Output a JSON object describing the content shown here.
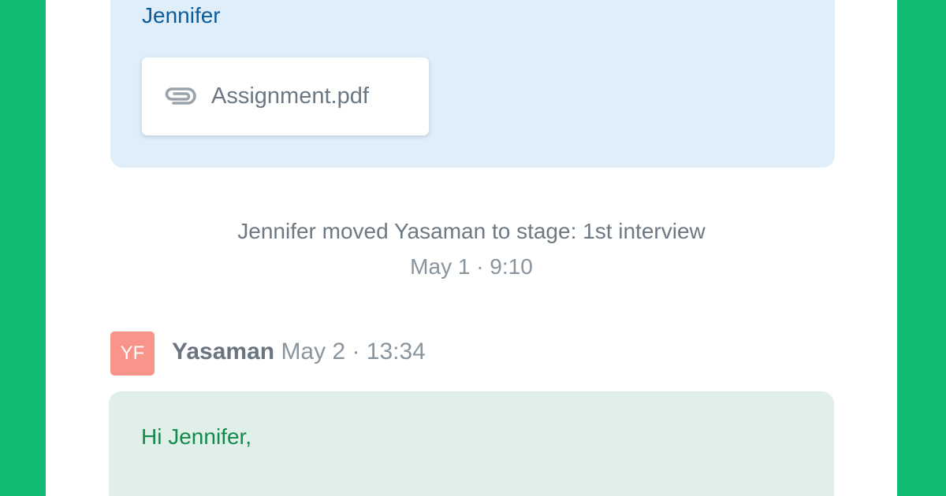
{
  "message_previous": {
    "sender": "Jennifer",
    "attachment": {
      "icon": "paperclip-icon",
      "filename": "Assignment.pdf"
    }
  },
  "event": {
    "text": "Jennifer moved Yasaman to stage: 1st interview",
    "timestamp": "May 1 · 9:10"
  },
  "message_current": {
    "avatar_initials": "YF",
    "author": "Yasaman",
    "timestamp": "May 2 · 13:34",
    "body": "Hi Jennifer,"
  },
  "colors": {
    "background": "#12bb72",
    "bubble_sent": "#e0eef9",
    "bubble_received": "#e0efe7",
    "avatar": "#f9948a",
    "sender_name": "#0b5c9a",
    "greeting": "#138a4c"
  }
}
